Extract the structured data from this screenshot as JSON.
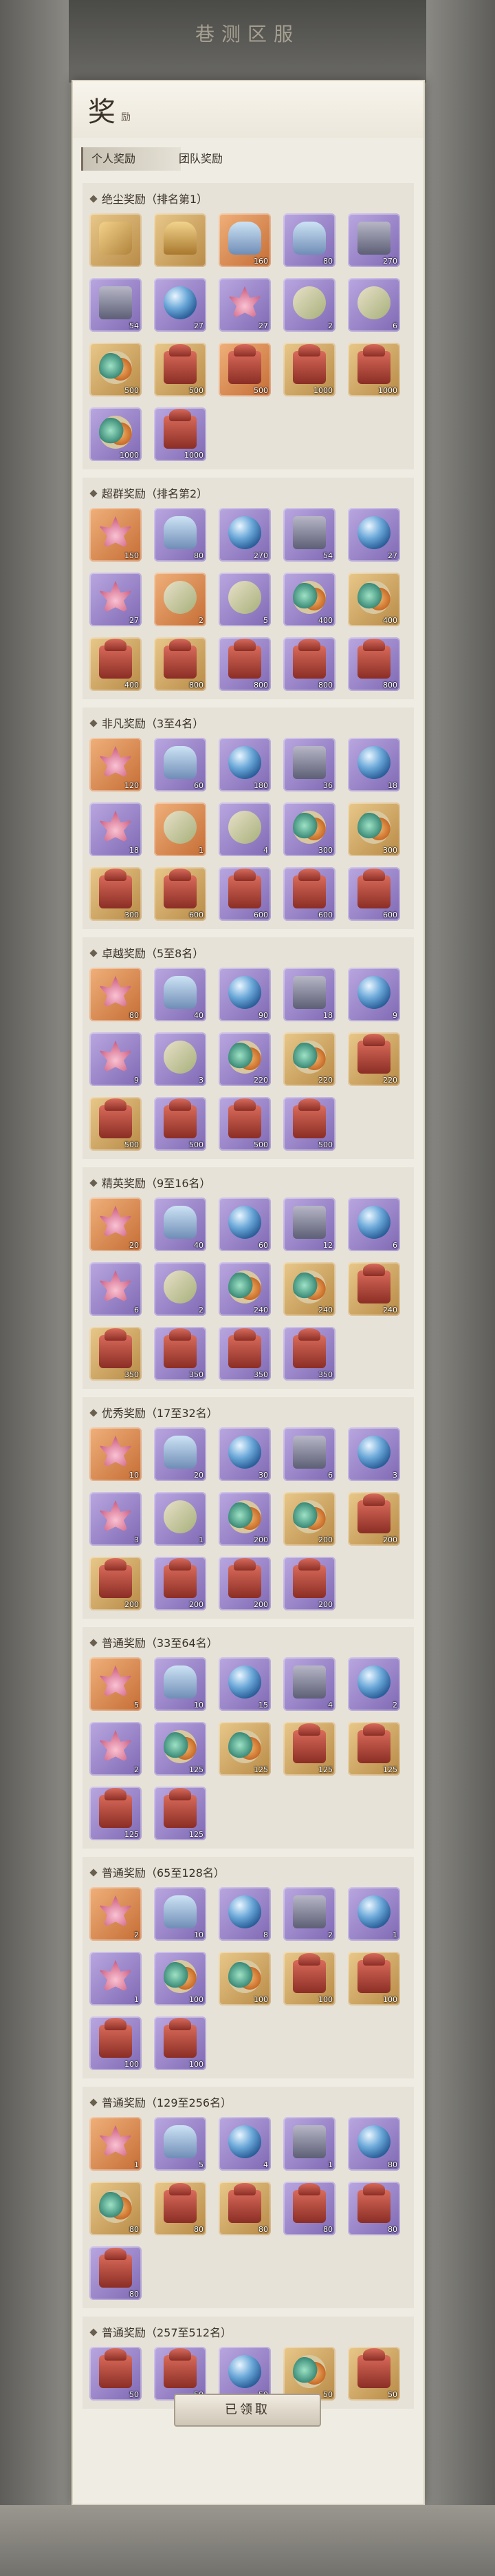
{
  "window": {
    "title": "巷测区服"
  },
  "panel": {
    "title": "奖",
    "subtitle": "励"
  },
  "tabs": [
    {
      "label": "个人奖励",
      "active": true
    },
    {
      "label": "团队奖励",
      "active": false
    }
  ],
  "sections": [
    {
      "title": "绝尘奖励（排名第1）",
      "items": [
        {
          "icon": "horse-icon",
          "tier": "gold",
          "qty": ""
        },
        {
          "icon": "bell-icon",
          "tier": "gold",
          "qty": ""
        },
        {
          "icon": "bottle-icon",
          "tier": "orange",
          "qty": "160"
        },
        {
          "icon": "bottle-icon",
          "tier": "purple",
          "qty": "80"
        },
        {
          "icon": "chest-icon",
          "tier": "purple",
          "qty": "270"
        },
        {
          "icon": "chest-icon",
          "tier": "purple",
          "qty": "54"
        },
        {
          "icon": "sphere-icon",
          "tier": "purple",
          "qty": "27"
        },
        {
          "icon": "lotus-icon",
          "tier": "purple",
          "qty": "27"
        },
        {
          "icon": "scroll-icon",
          "tier": "purple",
          "qty": "2"
        },
        {
          "icon": "scroll-icon",
          "tier": "purple",
          "qty": "6"
        },
        {
          "icon": "stones-icon",
          "tier": "gold",
          "qty": "500"
        },
        {
          "icon": "box-icon",
          "tier": "gold",
          "qty": "500"
        },
        {
          "icon": "box-icon",
          "tier": "orange",
          "qty": "500"
        },
        {
          "icon": "box-icon",
          "tier": "gold",
          "qty": "1000"
        },
        {
          "icon": "box-icon",
          "tier": "gold",
          "qty": "1000"
        },
        {
          "icon": "stones-icon",
          "tier": "purple",
          "qty": "1000"
        },
        {
          "icon": "box-icon",
          "tier": "purple",
          "qty": "1000"
        }
      ]
    },
    {
      "title": "超群奖励（排名第2）",
      "items": [
        {
          "icon": "lotus-icon",
          "tier": "orange",
          "qty": "150"
        },
        {
          "icon": "bottle-icon",
          "tier": "purple",
          "qty": "80"
        },
        {
          "icon": "sphere-icon",
          "tier": "purple",
          "qty": "270"
        },
        {
          "icon": "chest-icon",
          "tier": "purple",
          "qty": "54"
        },
        {
          "icon": "sphere-icon",
          "tier": "purple",
          "qty": "27"
        },
        {
          "icon": "lotus-icon",
          "tier": "purple",
          "qty": "27"
        },
        {
          "icon": "scroll-icon",
          "tier": "orange",
          "qty": "2"
        },
        {
          "icon": "scroll-icon",
          "tier": "purple",
          "qty": "5"
        },
        {
          "icon": "stones-icon",
          "tier": "purple",
          "qty": "400"
        },
        {
          "icon": "stones-icon",
          "tier": "gold",
          "qty": "400"
        },
        {
          "icon": "box-icon",
          "tier": "gold",
          "qty": "400"
        },
        {
          "icon": "box-icon",
          "tier": "gold",
          "qty": "800"
        },
        {
          "icon": "box-icon",
          "tier": "purple",
          "qty": "800"
        },
        {
          "icon": "box-icon",
          "tier": "purple",
          "qty": "800"
        },
        {
          "icon": "box-icon",
          "tier": "purple",
          "qty": "800"
        }
      ]
    },
    {
      "title": "非凡奖励（3至4名）",
      "items": [
        {
          "icon": "lotus-icon",
          "tier": "orange",
          "qty": "120"
        },
        {
          "icon": "bottle-icon",
          "tier": "purple",
          "qty": "60"
        },
        {
          "icon": "sphere-icon",
          "tier": "purple",
          "qty": "180"
        },
        {
          "icon": "chest-icon",
          "tier": "purple",
          "qty": "36"
        },
        {
          "icon": "sphere-icon",
          "tier": "purple",
          "qty": "18"
        },
        {
          "icon": "lotus-icon",
          "tier": "purple",
          "qty": "18"
        },
        {
          "icon": "scroll-icon",
          "tier": "orange",
          "qty": "1"
        },
        {
          "icon": "scroll-icon",
          "tier": "purple",
          "qty": "4"
        },
        {
          "icon": "stones-icon",
          "tier": "purple",
          "qty": "300"
        },
        {
          "icon": "stones-icon",
          "tier": "gold",
          "qty": "300"
        },
        {
          "icon": "box-icon",
          "tier": "gold",
          "qty": "300"
        },
        {
          "icon": "box-icon",
          "tier": "gold",
          "qty": "600"
        },
        {
          "icon": "box-icon",
          "tier": "purple",
          "qty": "600"
        },
        {
          "icon": "box-icon",
          "tier": "purple",
          "qty": "600"
        },
        {
          "icon": "box-icon",
          "tier": "purple",
          "qty": "600"
        }
      ]
    },
    {
      "title": "卓越奖励（5至8名）",
      "items": [
        {
          "icon": "lotus-icon",
          "tier": "orange",
          "qty": "80"
        },
        {
          "icon": "bottle-icon",
          "tier": "purple",
          "qty": "40"
        },
        {
          "icon": "sphere-icon",
          "tier": "purple",
          "qty": "90"
        },
        {
          "icon": "chest-icon",
          "tier": "purple",
          "qty": "18"
        },
        {
          "icon": "sphere-icon",
          "tier": "purple",
          "qty": "9"
        },
        {
          "icon": "lotus-icon",
          "tier": "purple",
          "qty": "9"
        },
        {
          "icon": "scroll-icon",
          "tier": "purple",
          "qty": "3"
        },
        {
          "icon": "stones-icon",
          "tier": "purple",
          "qty": "220"
        },
        {
          "icon": "stones-icon",
          "tier": "gold",
          "qty": "220"
        },
        {
          "icon": "box-icon",
          "tier": "gold",
          "qty": "220"
        },
        {
          "icon": "box-icon",
          "tier": "gold",
          "qty": "500"
        },
        {
          "icon": "box-icon",
          "tier": "purple",
          "qty": "500"
        },
        {
          "icon": "box-icon",
          "tier": "purple",
          "qty": "500"
        },
        {
          "icon": "box-icon",
          "tier": "purple",
          "qty": "500"
        }
      ]
    },
    {
      "title": "精英奖励（9至16名）",
      "items": [
        {
          "icon": "lotus-icon",
          "tier": "orange",
          "qty": "20"
        },
        {
          "icon": "bottle-icon",
          "tier": "purple",
          "qty": "40"
        },
        {
          "icon": "sphere-icon",
          "tier": "purple",
          "qty": "60"
        },
        {
          "icon": "chest-icon",
          "tier": "purple",
          "qty": "12"
        },
        {
          "icon": "sphere-icon",
          "tier": "purple",
          "qty": "6"
        },
        {
          "icon": "lotus-icon",
          "tier": "purple",
          "qty": "6"
        },
        {
          "icon": "scroll-icon",
          "tier": "purple",
          "qty": "2"
        },
        {
          "icon": "stones-icon",
          "tier": "purple",
          "qty": "240"
        },
        {
          "icon": "stones-icon",
          "tier": "gold",
          "qty": "240"
        },
        {
          "icon": "box-icon",
          "tier": "gold",
          "qty": "240"
        },
        {
          "icon": "box-icon",
          "tier": "gold",
          "qty": "350"
        },
        {
          "icon": "box-icon",
          "tier": "purple",
          "qty": "350"
        },
        {
          "icon": "box-icon",
          "tier": "purple",
          "qty": "350"
        },
        {
          "icon": "box-icon",
          "tier": "purple",
          "qty": "350"
        }
      ]
    },
    {
      "title": "优秀奖励（17至32名）",
      "items": [
        {
          "icon": "lotus-icon",
          "tier": "orange",
          "qty": "10"
        },
        {
          "icon": "bottle-icon",
          "tier": "purple",
          "qty": "20"
        },
        {
          "icon": "sphere-icon",
          "tier": "purple",
          "qty": "30"
        },
        {
          "icon": "chest-icon",
          "tier": "purple",
          "qty": "6"
        },
        {
          "icon": "sphere-icon",
          "tier": "purple",
          "qty": "3"
        },
        {
          "icon": "lotus-icon",
          "tier": "purple",
          "qty": "3"
        },
        {
          "icon": "scroll-icon",
          "tier": "purple",
          "qty": "1"
        },
        {
          "icon": "stones-icon",
          "tier": "purple",
          "qty": "200"
        },
        {
          "icon": "stones-icon",
          "tier": "gold",
          "qty": "200"
        },
        {
          "icon": "box-icon",
          "tier": "gold",
          "qty": "200"
        },
        {
          "icon": "box-icon",
          "tier": "gold",
          "qty": "200"
        },
        {
          "icon": "box-icon",
          "tier": "purple",
          "qty": "200"
        },
        {
          "icon": "box-icon",
          "tier": "purple",
          "qty": "200"
        },
        {
          "icon": "box-icon",
          "tier": "purple",
          "qty": "200"
        }
      ]
    },
    {
      "title": "普通奖励（33至64名）",
      "items": [
        {
          "icon": "lotus-icon",
          "tier": "orange",
          "qty": "5"
        },
        {
          "icon": "bottle-icon",
          "tier": "purple",
          "qty": "10"
        },
        {
          "icon": "sphere-icon",
          "tier": "purple",
          "qty": "15"
        },
        {
          "icon": "chest-icon",
          "tier": "purple",
          "qty": "4"
        },
        {
          "icon": "sphere-icon",
          "tier": "purple",
          "qty": "2"
        },
        {
          "icon": "lotus-icon",
          "tier": "purple",
          "qty": "2"
        },
        {
          "icon": "stones-icon",
          "tier": "purple",
          "qty": "125"
        },
        {
          "icon": "stones-icon",
          "tier": "gold",
          "qty": "125"
        },
        {
          "icon": "box-icon",
          "tier": "gold",
          "qty": "125"
        },
        {
          "icon": "box-icon",
          "tier": "gold",
          "qty": "125"
        },
        {
          "icon": "box-icon",
          "tier": "purple",
          "qty": "125"
        },
        {
          "icon": "box-icon",
          "tier": "purple",
          "qty": "125"
        }
      ]
    },
    {
      "title": "普通奖励（65至128名）",
      "items": [
        {
          "icon": "lotus-icon",
          "tier": "orange",
          "qty": "2"
        },
        {
          "icon": "bottle-icon",
          "tier": "purple",
          "qty": "10"
        },
        {
          "icon": "sphere-icon",
          "tier": "purple",
          "qty": "8"
        },
        {
          "icon": "chest-icon",
          "tier": "purple",
          "qty": "2"
        },
        {
          "icon": "sphere-icon",
          "tier": "purple",
          "qty": "1"
        },
        {
          "icon": "lotus-icon",
          "tier": "purple",
          "qty": "1"
        },
        {
          "icon": "stones-icon",
          "tier": "purple",
          "qty": "100"
        },
        {
          "icon": "stones-icon",
          "tier": "gold",
          "qty": "100"
        },
        {
          "icon": "box-icon",
          "tier": "gold",
          "qty": "100"
        },
        {
          "icon": "box-icon",
          "tier": "gold",
          "qty": "100"
        },
        {
          "icon": "box-icon",
          "tier": "purple",
          "qty": "100"
        },
        {
          "icon": "box-icon",
          "tier": "purple",
          "qty": "100"
        }
      ]
    },
    {
      "title": "普通奖励（129至256名）",
      "items": [
        {
          "icon": "lotus-icon",
          "tier": "orange",
          "qty": "1"
        },
        {
          "icon": "bottle-icon",
          "tier": "purple",
          "qty": "5"
        },
        {
          "icon": "sphere-icon",
          "tier": "purple",
          "qty": "4"
        },
        {
          "icon": "chest-icon",
          "tier": "purple",
          "qty": "1"
        },
        {
          "icon": "sphere-icon",
          "tier": "purple",
          "qty": "80"
        },
        {
          "icon": "stones-icon",
          "tier": "gold",
          "qty": "80"
        },
        {
          "icon": "box-icon",
          "tier": "gold",
          "qty": "80"
        },
        {
          "icon": "box-icon",
          "tier": "gold",
          "qty": "80"
        },
        {
          "icon": "box-icon",
          "tier": "purple",
          "qty": "80"
        },
        {
          "icon": "box-icon",
          "tier": "purple",
          "qty": "80"
        },
        {
          "icon": "box-icon",
          "tier": "purple",
          "qty": "80"
        }
      ]
    },
    {
      "title": "普通奖励（257至512名）",
      "items": [
        {
          "icon": "box-icon",
          "tier": "purple",
          "qty": "50"
        },
        {
          "icon": "box-icon",
          "tier": "purple",
          "qty": "50"
        },
        {
          "icon": "sphere-icon",
          "tier": "purple",
          "qty": "50"
        },
        {
          "icon": "stones-icon",
          "tier": "gold",
          "qty": "50"
        },
        {
          "icon": "box-icon",
          "tier": "gold",
          "qty": "50"
        }
      ]
    }
  ],
  "footer": {
    "claimed_label": "已领取"
  }
}
